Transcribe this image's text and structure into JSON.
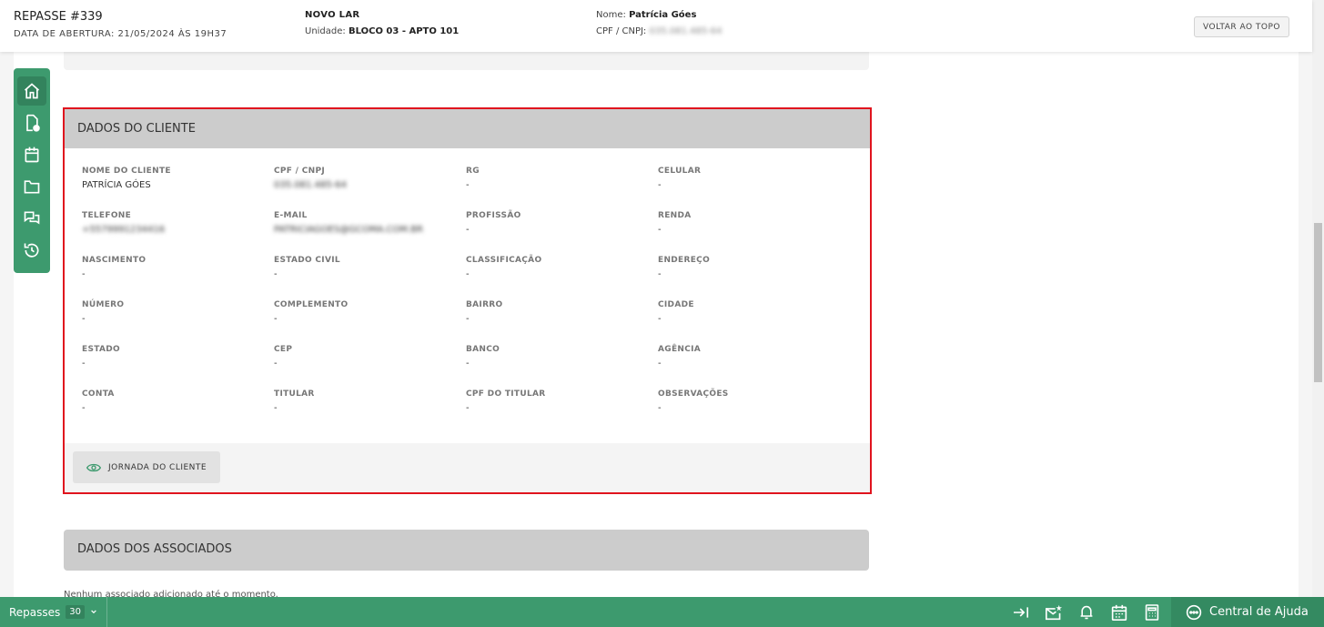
{
  "header": {
    "title": "REPASSE #339",
    "opened": "DATA DE ABERTURA: 21/05/2024 ÀS 19H37",
    "project": "NOVO LAR",
    "unit_label": "Unidade:",
    "unit_value": "BLOCO 03 - APTO 101",
    "name_label": "Nome:",
    "name_value": "Patrícia Góes",
    "doc_label": "CPF / CNPJ:",
    "doc_value": "035.081.485-64",
    "back_to_top": "VOLTAR AO TOPO"
  },
  "sidenav": {
    "items": [
      {
        "icon": "home-icon"
      },
      {
        "icon": "document-icon"
      },
      {
        "icon": "calendar-icon"
      },
      {
        "icon": "folder-icon"
      },
      {
        "icon": "chat-icon"
      },
      {
        "icon": "history-icon"
      }
    ]
  },
  "client": {
    "title": "DADOS DO CLIENTE",
    "fields": [
      {
        "label": "NOME DO CLIENTE",
        "value": "PATRÍCIA GÓES"
      },
      {
        "label": "CPF / CNPJ",
        "value": "035.081.485-64",
        "blurred": true
      },
      {
        "label": "RG",
        "value": "-"
      },
      {
        "label": "CELULAR",
        "value": "-"
      },
      {
        "label": "TELEFONE",
        "value": "+5579991234416",
        "blurred": true
      },
      {
        "label": "E-MAIL",
        "value": "PATRICIAGOES@GCOMA.COM.BR",
        "blurred": true
      },
      {
        "label": "PROFISSÃO",
        "value": "-"
      },
      {
        "label": "RENDA",
        "value": "-"
      },
      {
        "label": "NASCIMENTO",
        "value": "-"
      },
      {
        "label": "ESTADO CIVIL",
        "value": "-"
      },
      {
        "label": "CLASSIFICAÇÃO",
        "value": "-"
      },
      {
        "label": "ENDEREÇO",
        "value": "-"
      },
      {
        "label": "NÚMERO",
        "value": "-"
      },
      {
        "label": "COMPLEMENTO",
        "value": "-"
      },
      {
        "label": "BAIRRO",
        "value": "-"
      },
      {
        "label": "CIDADE",
        "value": "-"
      },
      {
        "label": "ESTADO",
        "value": "-"
      },
      {
        "label": "CEP",
        "value": "-"
      },
      {
        "label": "BANCO",
        "value": "-"
      },
      {
        "label": "AGÊNCIA",
        "value": "-"
      },
      {
        "label": "CONTA",
        "value": "-"
      },
      {
        "label": "TITULAR",
        "value": "-"
      },
      {
        "label": "CPF DO TITULAR",
        "value": "-"
      },
      {
        "label": "OBSERVAÇÕES",
        "value": "-"
      }
    ],
    "journey_button": "JORNADA DO CLIENTE"
  },
  "associates": {
    "title": "DADOS DOS ASSOCIADOS",
    "empty": "Nenhum associado adicionado até o momento."
  },
  "bottombar": {
    "repasses_label": "Repasses",
    "repasses_count": "30",
    "help_label": "Central de Ajuda",
    "icons": [
      "collapse-right-icon",
      "mail-star-icon",
      "bell-icon",
      "calendar-icon",
      "calculator-icon"
    ]
  },
  "colors": {
    "brand": "#3d9a6e",
    "highlight": "#e0141e"
  }
}
